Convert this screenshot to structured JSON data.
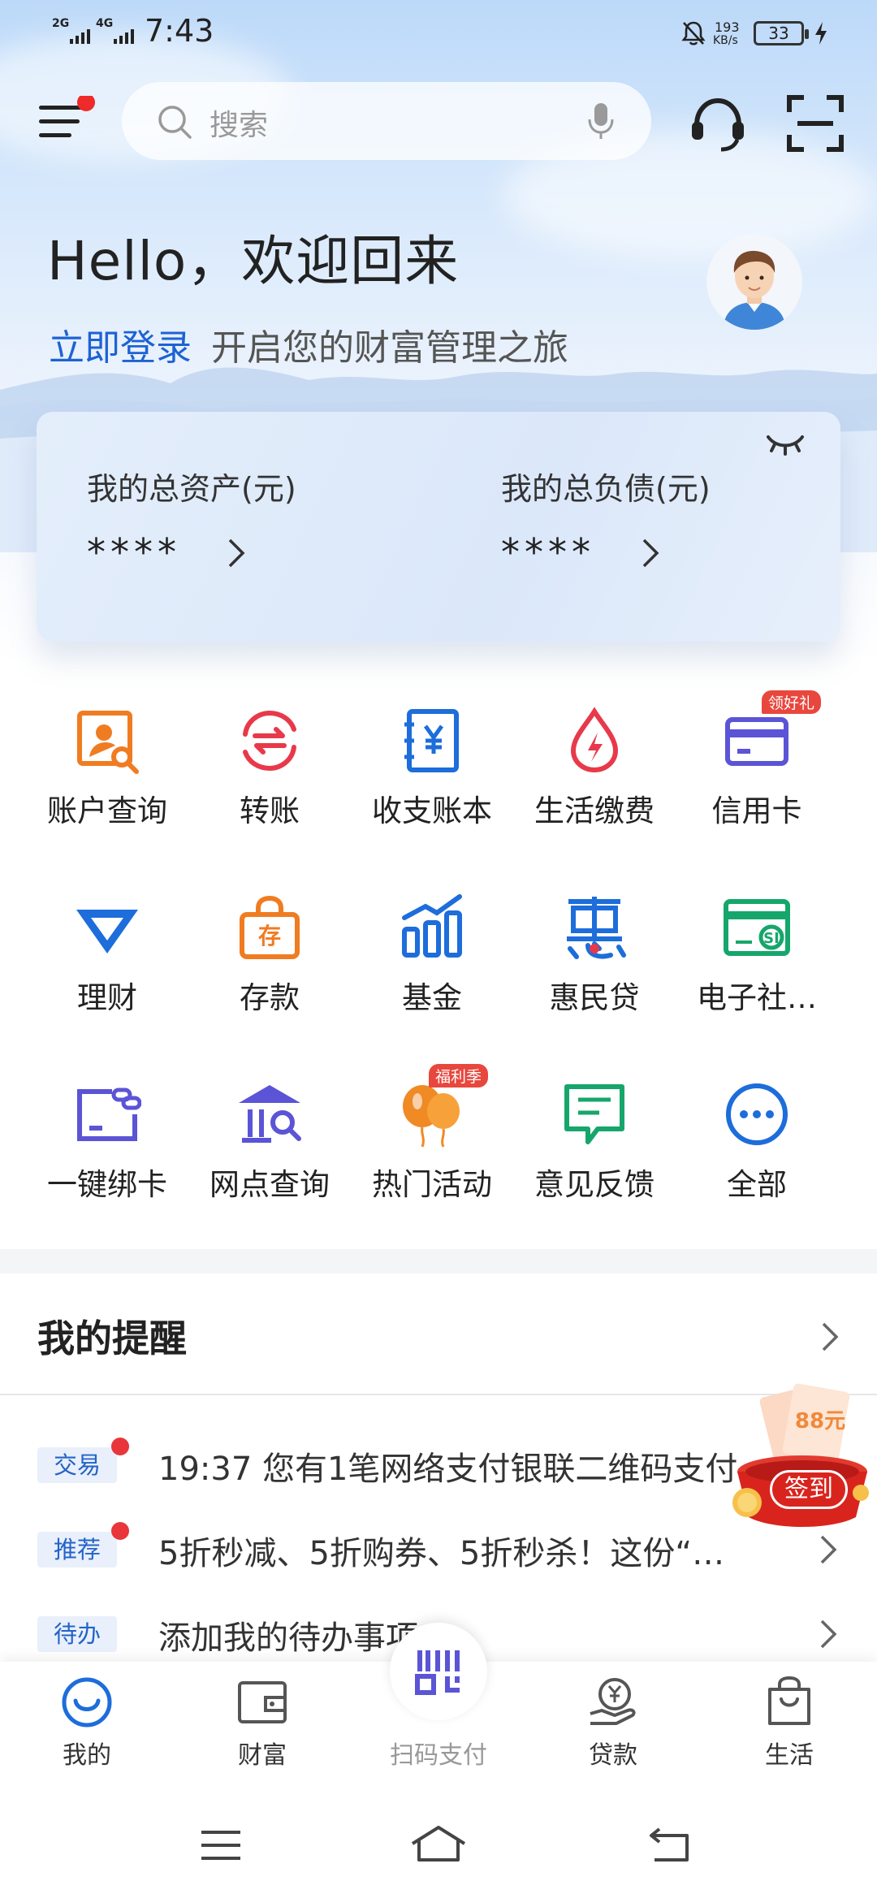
{
  "status_bar": {
    "net1": "2G",
    "net2": "4G",
    "time": "7:43",
    "speed_value": "193",
    "speed_unit": "KB/s",
    "battery": "33"
  },
  "header": {
    "search_placeholder": "搜索"
  },
  "welcome": {
    "greeting": "Hello，欢迎回来",
    "login_link": "立即登录",
    "subtitle": "开启您的财富管理之旅"
  },
  "assets": {
    "total_assets_label": "我的总资产(元)",
    "total_assets_value": "****",
    "total_debt_label": "我的总负债(元)",
    "total_debt_value": "****"
  },
  "services": [
    {
      "label": "账户查询",
      "icon": "account-query-icon"
    },
    {
      "label": "转账",
      "icon": "transfer-icon"
    },
    {
      "label": "收支账本",
      "icon": "ledger-icon"
    },
    {
      "label": "生活缴费",
      "icon": "utility-payment-icon"
    },
    {
      "label": "信用卡",
      "icon": "credit-card-icon",
      "badge": "领好礼"
    },
    {
      "label": "理财",
      "icon": "wealth-icon"
    },
    {
      "label": "存款",
      "icon": "deposit-icon"
    },
    {
      "label": "基金",
      "icon": "fund-icon"
    },
    {
      "label": "惠民贷",
      "icon": "hui-loan-icon"
    },
    {
      "label": "电子社…",
      "icon": "social-security-card-icon"
    },
    {
      "label": "一键绑卡",
      "icon": "bind-card-icon"
    },
    {
      "label": "网点查询",
      "icon": "branch-query-icon"
    },
    {
      "label": "热门活动",
      "icon": "balloon-icon",
      "badge": "福利季"
    },
    {
      "label": "意见反馈",
      "icon": "feedback-icon"
    },
    {
      "label": "全部",
      "icon": "more-icon"
    }
  ],
  "reminders": {
    "title": "我的提醒",
    "items": [
      {
        "tag": "交易",
        "text": "19:37 您有1笔网络支付银联二维码支付"
      },
      {
        "tag": "推荐",
        "text": "5折秒减、5折购券、5折秒杀！这份“…"
      },
      {
        "tag": "待办",
        "text": "添加我的待办事项"
      }
    ]
  },
  "floating": {
    "checkin_label": "签到",
    "ticket_text": "88元"
  },
  "tabbar": {
    "tabs": [
      "我的",
      "财富",
      "扫码支付",
      "贷款",
      "生活"
    ]
  },
  "colors": {
    "accent": "#1d62d4",
    "badge": "#e8473d",
    "orange": "#f08a24",
    "green": "#16a66b",
    "purple": "#5b54d6"
  }
}
